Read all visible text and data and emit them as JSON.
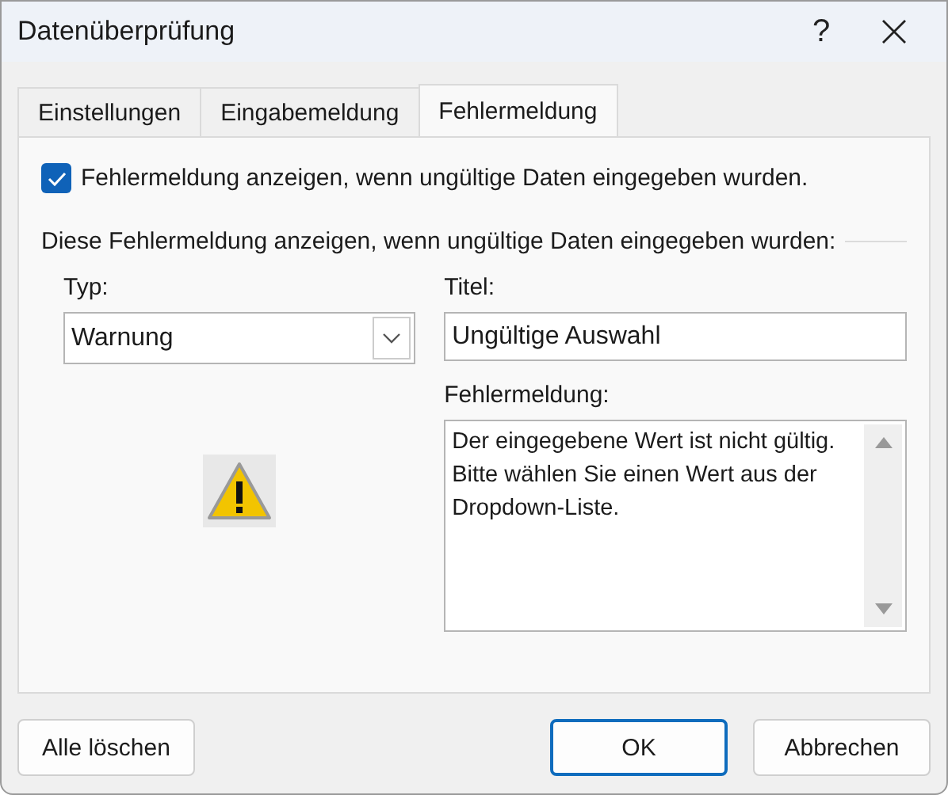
{
  "window": {
    "title": "Datenüberprüfung",
    "help": "?"
  },
  "tabs": [
    {
      "label": "Einstellungen",
      "selected": false
    },
    {
      "label": "Eingabemeldung",
      "selected": false
    },
    {
      "label": "Fehlermeldung",
      "selected": true
    }
  ],
  "show_error": {
    "label": "Fehlermeldung anzeigen, wenn ungültige Daten eingegeben wurden.",
    "checked": true
  },
  "group_label": "Diese Fehlermeldung anzeigen, wenn ungültige Daten eingegeben wurden:",
  "type": {
    "label": "Typ:",
    "value": "Warnung"
  },
  "title_field": {
    "label": "Titel:",
    "value": "Ungültige Auswahl"
  },
  "message": {
    "label": "Fehlermeldung:",
    "value": "Der eingegebene Wert ist nicht gültig. Bitte wählen Sie einen Wert aus der Dropdown-Liste."
  },
  "buttons": [
    {
      "label": "Alle löschen",
      "default": false
    },
    {
      "label": "OK",
      "default": true
    },
    {
      "label": "Abbrechen",
      "default": false
    }
  ]
}
